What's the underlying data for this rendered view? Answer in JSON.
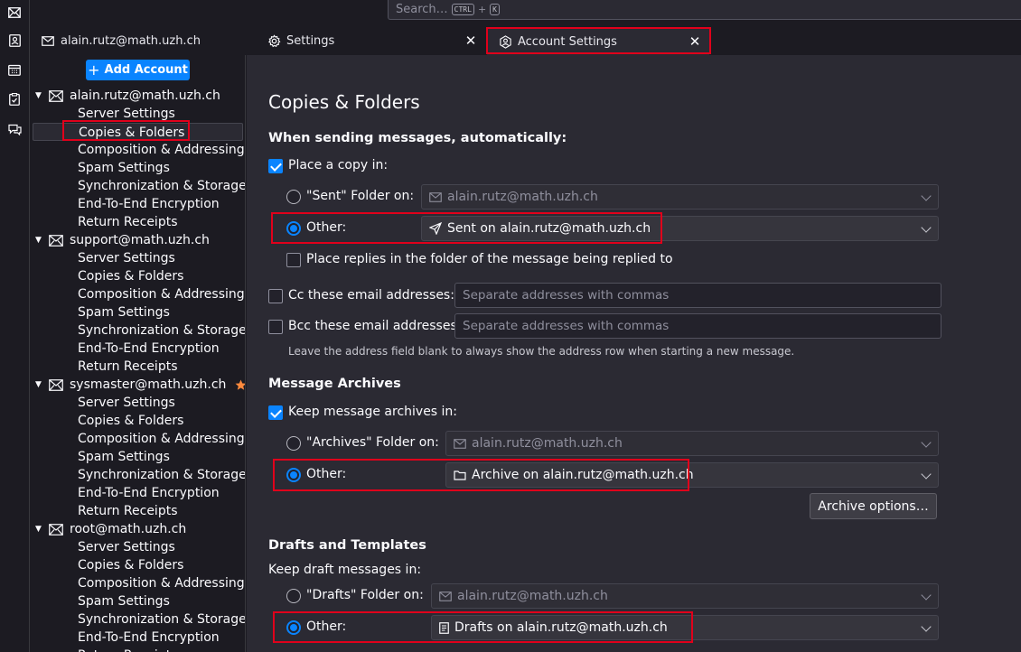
{
  "search": {
    "placeholder": "Search…",
    "key1": "CTRL",
    "plus": "+",
    "key2": "K"
  },
  "tabs": [
    {
      "label": "alain.rutz@math.uzh.ch"
    },
    {
      "label": "Settings"
    },
    {
      "label": "Account Settings"
    }
  ],
  "sidebar": {
    "add_label": "Add Account",
    "accounts": [
      {
        "name": "alain.rutz@math.uzh.ch"
      },
      {
        "name": "support@math.uzh.ch"
      },
      {
        "name": "sysmaster@math.uzh.ch"
      },
      {
        "name": "root@math.uzh.ch"
      }
    ],
    "items": [
      "Server Settings",
      "Copies & Folders",
      "Composition & Addressing",
      "Spam Settings",
      "Synchronization & Storage",
      "End-To-End Encryption",
      "Return Receipts"
    ],
    "selected": "Copies & Folders"
  },
  "page": {
    "title": "Copies & Folders",
    "sending": {
      "heading": "When sending messages, automatically:",
      "place_copy": "Place a copy in:",
      "sent_radio": "\"Sent\" Folder on:",
      "sent_account": "alain.rutz@math.uzh.ch",
      "other": "Other:",
      "other_folder": "Sent on alain.rutz@math.uzh.ch",
      "replies": "Place replies in the folder of the message being replied to",
      "cc": "Cc these email addresses:",
      "bcc": "Bcc these email addresses:",
      "addr_placeholder": "Separate addresses with commas",
      "hint": "Leave the address field blank to always show the address row when starting a new message."
    },
    "archives": {
      "heading": "Message Archives",
      "keep": "Keep message archives in:",
      "archives_radio": "\"Archives\" Folder on:",
      "archives_account": "alain.rutz@math.uzh.ch",
      "other": "Other:",
      "other_folder": "Archive on alain.rutz@math.uzh.ch",
      "options_button": "Archive options…"
    },
    "drafts": {
      "heading": "Drafts and Templates",
      "keep": "Keep draft messages in:",
      "drafts_radio": "\"Drafts\" Folder on:",
      "drafts_account": "alain.rutz@math.uzh.ch",
      "other": "Other:",
      "other_folder": "Drafts on alain.rutz@math.uzh.ch"
    }
  },
  "colors": {
    "accent": "#0a84ff",
    "highlight": "#e0001b",
    "star": "#ff8a3d"
  }
}
